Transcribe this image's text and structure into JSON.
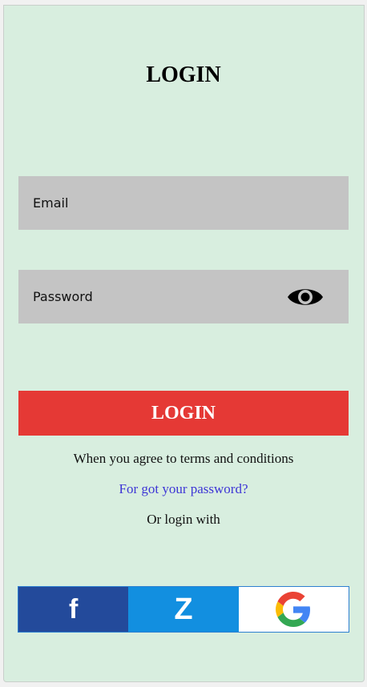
{
  "title": "LOGIN",
  "email": {
    "label": "Email"
  },
  "password": {
    "label": "Password",
    "toggle_icon": "eye-icon"
  },
  "login_button": "LOGIN",
  "terms_text": "When you agree to terms and conditions",
  "forgot_link": "For got your password?",
  "or_text": "Or login with",
  "social": {
    "facebook": {
      "icon": "facebook-icon",
      "glyph": "f",
      "color": "#234a9b"
    },
    "zalo": {
      "icon": "zalo-icon",
      "glyph": "Z",
      "color": "#128fe0"
    },
    "google": {
      "icon": "google-icon"
    }
  },
  "colors": {
    "background": "#d8eedf",
    "field": "#c4c4c4",
    "primary": "#e53935",
    "link": "#3d35d6"
  }
}
